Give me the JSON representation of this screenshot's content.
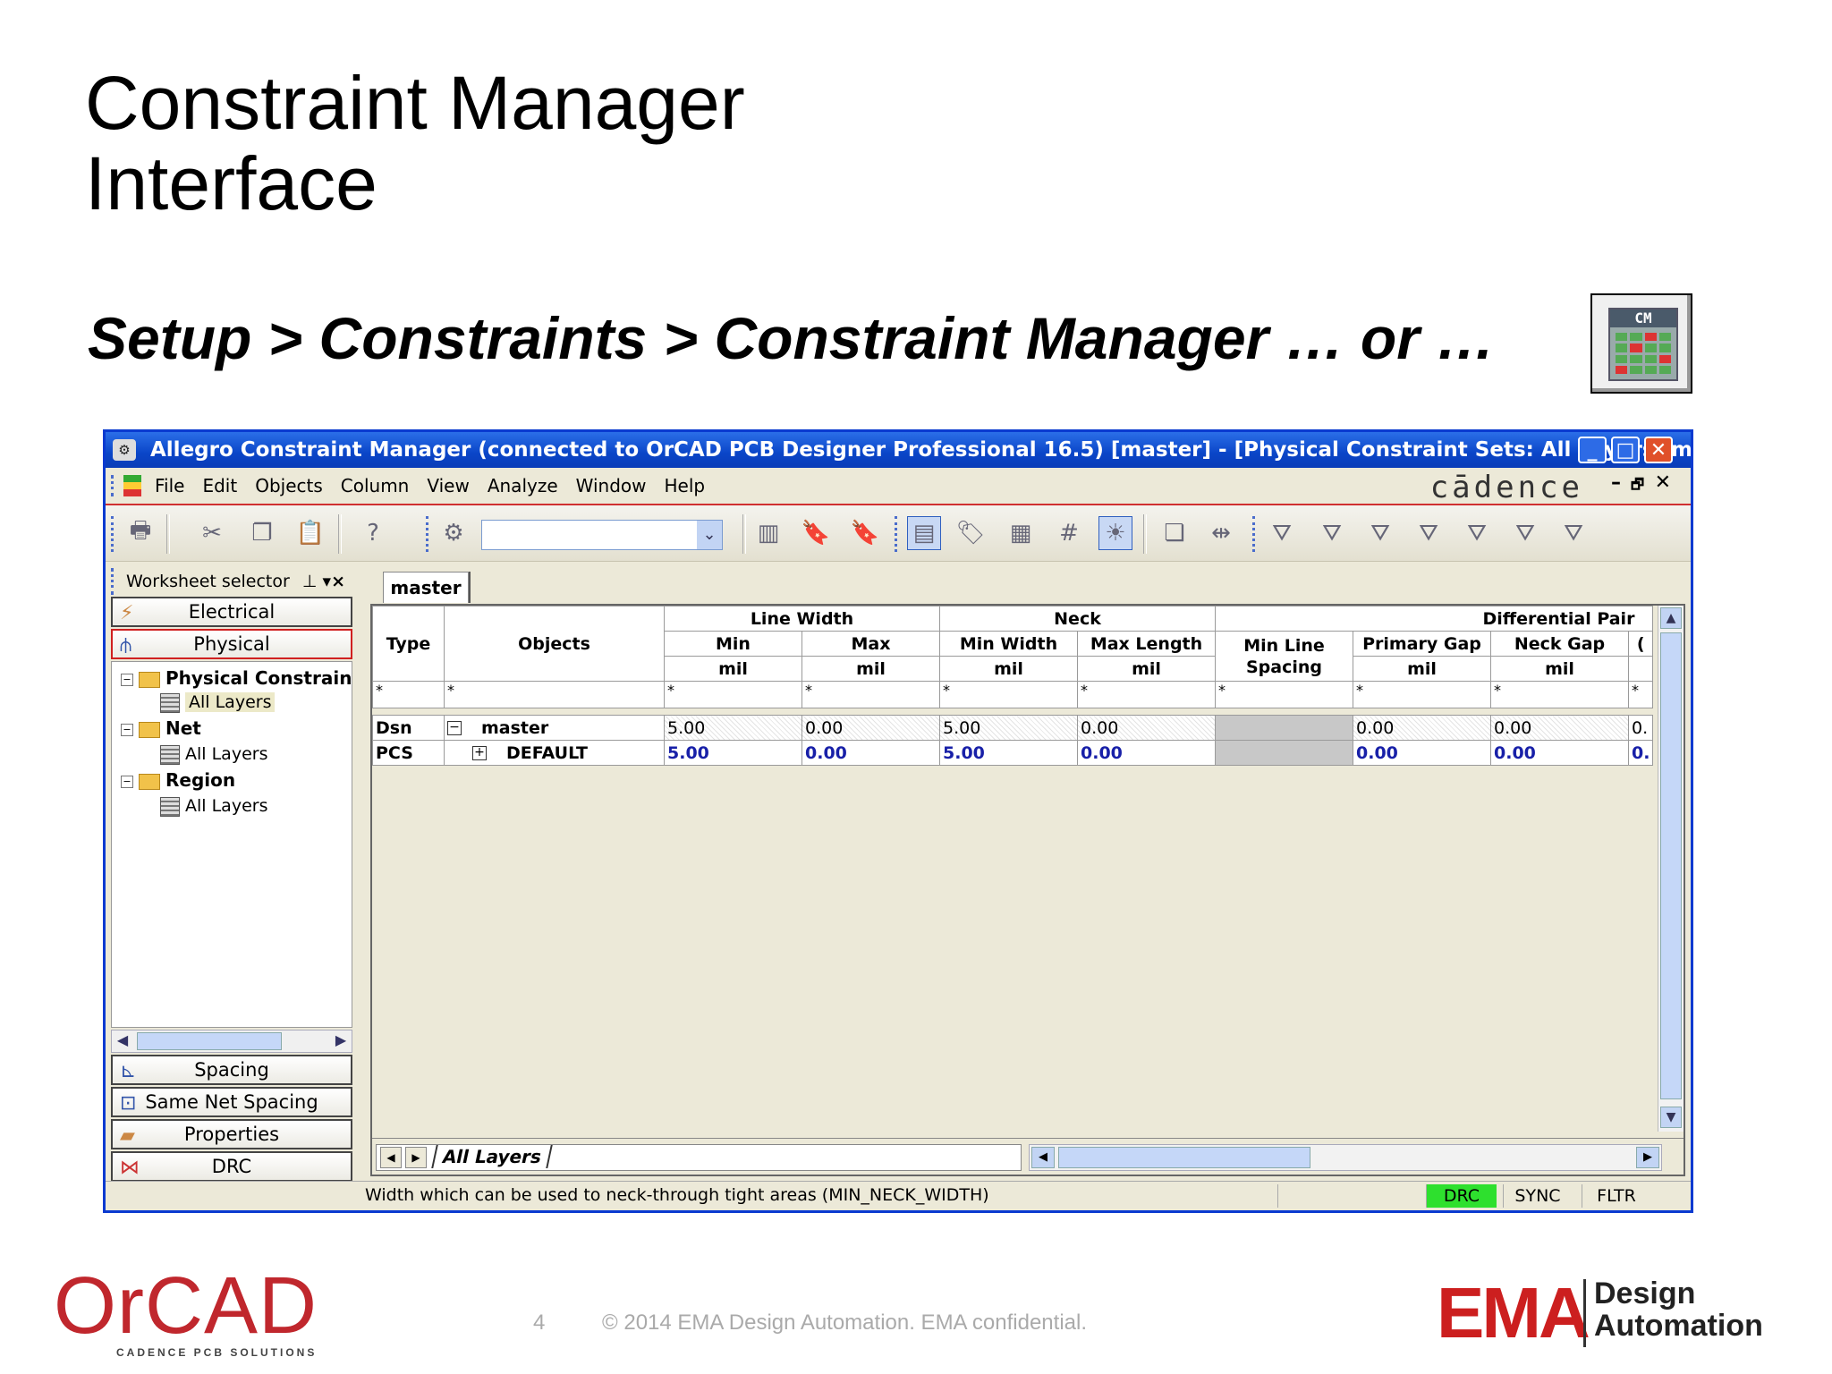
{
  "slide": {
    "title_line1": "Constraint Manager",
    "title_line2": "Interface",
    "subtitle": "Setup > Constraints > Constraint Manager … or …",
    "cm_icon_label": "CM"
  },
  "window": {
    "title": "Allegro Constraint Manager (connected to OrCAD PCB Designer Professional 16.5) [master] - [Physical Constraint Sets:  All Layers [master] ]",
    "brand": "cādence",
    "menu": [
      "File",
      "Edit",
      "Objects",
      "Column",
      "View",
      "Analyze",
      "Window",
      "Help"
    ]
  },
  "worksheet_selector": {
    "header": "Worksheet selector",
    "tabs_top": [
      "Electrical",
      "Physical"
    ],
    "tree": {
      "physical_sets": "Physical Constrain",
      "all_layers_1": "All Layers",
      "net": "Net",
      "all_layers_2": "All Layers",
      "region": "Region",
      "all_layers_3": "All Layers"
    },
    "tabs_bottom": [
      "Spacing",
      "Same Net Spacing",
      "Properties",
      "DRC"
    ]
  },
  "sheet": {
    "doc_tab": "master",
    "groups": {
      "line_width": "Line Width",
      "neck": "Neck",
      "diff_pair": "Differential Pair"
    },
    "columns": {
      "type": "Type",
      "objects": "Objects",
      "lw_min": "Min",
      "lw_max": "Max",
      "neck_min_width": "Min Width",
      "neck_max_length": "Max Length",
      "dp_min_line_spacing_1": "Min Line",
      "dp_min_line_spacing_2": "Spacing",
      "dp_primary_gap": "Primary Gap",
      "dp_neck_gap": "Neck Gap",
      "dp_cut": "("
    },
    "unit": "mil",
    "filter_char": "*",
    "rows": [
      {
        "type": "Dsn",
        "toggle": "−",
        "object": "master",
        "lw_min": "5.00",
        "lw_max": "0.00",
        "neck_min": "5.00",
        "neck_max": "0.00",
        "min_line": "",
        "primary_gap": "0.00",
        "neck_gap": "0.00",
        "extra": "0."
      },
      {
        "type": "PCS",
        "toggle": "+",
        "object": "DEFAULT",
        "lw_min": "5.00",
        "lw_max": "0.00",
        "neck_min": "5.00",
        "neck_max": "0.00",
        "min_line": "",
        "primary_gap": "0.00",
        "neck_gap": "0.00",
        "extra": "0."
      }
    ],
    "sheet_tab": "All Layers"
  },
  "status": {
    "message": "Width which can be used to neck-through tight areas (MIN_NECK_WIDTH)",
    "drc": "DRC",
    "sync": "SYNC",
    "fltr": "FLTR"
  },
  "footer": {
    "orcad": "OrCAD",
    "orcad_tag": "CADENCE PCB SOLUTIONS",
    "page": "4",
    "copyright": "© 2014 EMA Design Automation. EMA confidential.",
    "ema": "EMA",
    "ema_line1": "Design",
    "ema_line2": "Automation"
  },
  "colors": {
    "titlebar": "#0a45c8",
    "active_tab_border": "#d02020",
    "drc_status": "#2ee02e",
    "pcs_value": "#1820a8",
    "ema_red": "#cc1f1f",
    "orcad_red": "#c0272d"
  }
}
